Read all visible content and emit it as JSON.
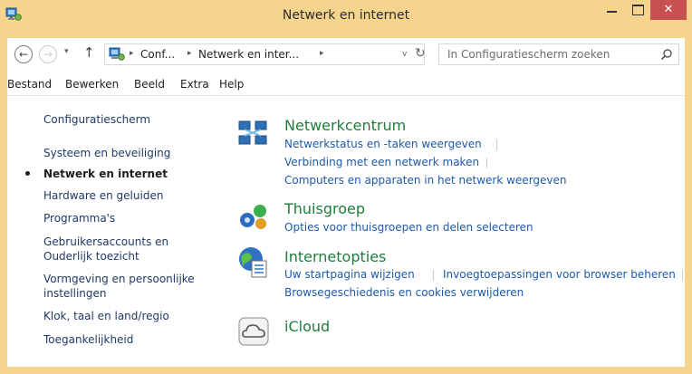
{
  "window": {
    "title": "Netwerk en internet",
    "close_label": "✕",
    "app_icon": "control-panel-icon"
  },
  "nav": {
    "back_glyph": "←",
    "forward_glyph": "→",
    "recent_glyph": "▾",
    "up_glyph": "↑"
  },
  "address": {
    "crumbs": [
      "Conf...",
      "Netwerk en inter..."
    ],
    "separator": "▸",
    "dropdown_glyph": "v",
    "refresh_glyph": "↻"
  },
  "search": {
    "placeholder": "In Configuratiescherm zoeken"
  },
  "menu": [
    "Bestand",
    "Bewerken",
    "Beeld",
    "Extra",
    "Help"
  ],
  "sidebar": {
    "items": [
      {
        "label": "Configuratiescherm",
        "active": false
      },
      {
        "label": "Systeem en beveiliging",
        "active": false
      },
      {
        "label": "Netwerk en internet",
        "active": true
      },
      {
        "label": "Hardware en geluiden",
        "active": false
      },
      {
        "label": "Programma's",
        "active": false
      },
      {
        "label": "Gebruikersaccounts en",
        "label2": "Ouderlijk toezicht",
        "active": false
      },
      {
        "label": "Vormgeving en persoonlijke",
        "label2": "instellingen",
        "active": false
      },
      {
        "label": "Klok, taal en land/regio",
        "active": false
      },
      {
        "label": "Toegankelijkheid",
        "active": false
      }
    ]
  },
  "categories": [
    {
      "title": "Netwerkcentrum",
      "icon": "network-center-icon",
      "tasks": [
        "Netwerkstatus en -taken weergeven",
        "Verbinding met een netwerk maken",
        "Computers en apparaten in het netwerk weergeven"
      ]
    },
    {
      "title": "Thuisgroep",
      "icon": "homegroup-icon",
      "tasks": [
        "Opties voor thuisgroepen en delen selecteren"
      ]
    },
    {
      "title": "Internetopties",
      "icon": "internet-options-icon",
      "tasks": [
        "Uw startpagina wijzigen",
        "Invoegtoepassingen voor browser beheren",
        "Browsegeschiedenis en cookies verwijderen"
      ]
    },
    {
      "title": "iCloud",
      "icon": "icloud-icon",
      "tasks": []
    }
  ],
  "colors": {
    "frame": "#f5d48e",
    "close_button": "#c75050",
    "category_title": "#1e7d3c",
    "task_link": "#1e5aa8"
  }
}
